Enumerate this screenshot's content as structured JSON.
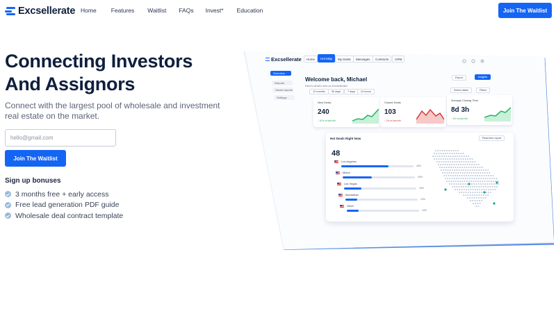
{
  "brand": {
    "name": "Excsellerate",
    "accent": "#1565f5",
    "text_dark": "#0f1f3d"
  },
  "nav": {
    "links": [
      "Home",
      "Features",
      "Waitlist",
      "FAQs",
      "Invest*",
      "Education"
    ],
    "cta_label": "Join The Waitlist"
  },
  "hero": {
    "headline_line1": "Connecting Investors",
    "headline_line2": "And Assignors",
    "subtext": "Connect with the largest pool of wholesale and investment real estate on the market.",
    "email_placeholder": "hello@gmail.com",
    "cta_label": "Join The Waitlist",
    "bonus_title": "Sign up bonuses",
    "bonuses": [
      "3 months free + early access",
      "Free lead generation PDF guide",
      "Wholesale deal contract template"
    ]
  },
  "mockup": {
    "logo": "Excsellerate",
    "tabs": [
      "Home",
      "Hot Map",
      "My Deals",
      "Messages",
      "Contracts",
      "CRM"
    ],
    "active_tab": "Hot Map",
    "sidebar": [
      "Overview",
      "Reports",
      "Saved reports",
      "Settings"
    ],
    "active_sidebar": "Overview",
    "welcome": "Welcome back, Michael",
    "welcome_sub": "Here's what's new on Excsellerate.",
    "header_buttons": [
      "Export",
      "Insights"
    ],
    "ranges": [
      "12 months",
      "30 days",
      "7 days",
      "24 hours"
    ],
    "filter_buttons": [
      "Select dates",
      "Filters"
    ],
    "stats": [
      {
        "label": "New Deals",
        "value": "240",
        "badge": "↑ 10% vs last mth",
        "trend": "up"
      },
      {
        "label": "Closed Deals",
        "value": "103",
        "badge": "↓ 2% vs last mth",
        "trend": "down"
      },
      {
        "label": "Average Closing Time",
        "value": "8d 3h",
        "badge": "↑ 4% vs last mth",
        "trend": "up"
      }
    ],
    "hot_deals": {
      "title": "Hot Deals Right Now",
      "button": "Real-time report",
      "total": "48",
      "cities": [
        {
          "name": "Los Angeles",
          "pct": "40%",
          "fill": 0.4
        },
        {
          "name": "Miami",
          "pct": "25%",
          "fill": 0.25
        },
        {
          "name": "Las Vegas",
          "pct": "15%",
          "fill": 0.15
        },
        {
          "name": "Manhattan",
          "pct": "10%",
          "fill": 0.1
        },
        {
          "name": "Other",
          "pct": "10%",
          "fill": 0.1
        }
      ]
    }
  }
}
